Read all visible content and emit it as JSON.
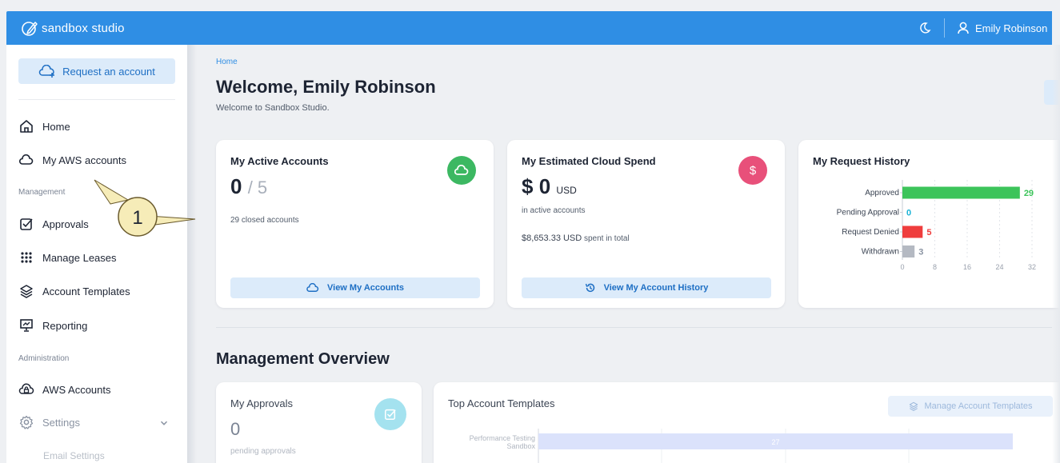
{
  "topbar": {
    "brand": "sandbox studio",
    "user_name": "Emily Robinson"
  },
  "sidebar": {
    "request_button": "Request an account",
    "items": [
      {
        "label": "Home",
        "icon": "home-icon"
      },
      {
        "label": "My AWS accounts",
        "icon": "cloud-icon"
      },
      {
        "label": "Approvals",
        "icon": "checkbox-icon"
      },
      {
        "label": "Manage Leases",
        "icon": "grid-dots-icon"
      },
      {
        "label": "Account Templates",
        "icon": "stack-icon"
      },
      {
        "label": "Reporting",
        "icon": "presentation-icon"
      },
      {
        "label": "AWS Accounts",
        "icon": "cloud-lock-icon"
      },
      {
        "label": "Settings",
        "icon": "gear-icon"
      },
      {
        "label": "Email Settings",
        "icon": ""
      }
    ],
    "sections": {
      "management": "Management",
      "administration": "Administration"
    }
  },
  "callout": {
    "number": "1"
  },
  "main": {
    "breadcrumb": "Home",
    "title": "Welcome, Emily Robinson",
    "subtitle": "Welcome to Sandbox Studio.",
    "active_accounts": {
      "title": "My Active Accounts",
      "count": "0",
      "limit": "/ 5",
      "closed_count": "29",
      "closed_label": "closed accounts",
      "button": "View My Accounts"
    },
    "cloud_spend": {
      "title": "My Estimated Cloud Spend",
      "currency_symbol": "$",
      "amount": "0",
      "currency": "USD",
      "note": "in active accounts",
      "total": "$8,653.33 USD",
      "total_label": "spent in total",
      "button": "View My Account History"
    },
    "request_history": {
      "title": "My Request History"
    },
    "management_overview": {
      "title": "Management Overview",
      "approvals": {
        "title": "My Approvals",
        "count": "0",
        "label": "pending approvals"
      },
      "top_templates": {
        "title": "Top Account Templates",
        "button": "Manage Account Templates"
      }
    }
  },
  "colors": {
    "topbar": "#2f8ee4",
    "approved": "#3cc45a",
    "pending": "#19b2d6",
    "denied": "#ef3d3d",
    "withdrawn": "#b4b9c2",
    "green_icon": "#3cb862",
    "pink_icon": "#e8507a"
  },
  "chart_data": [
    {
      "type": "bar",
      "orientation": "horizontal",
      "title": "My Request History",
      "categories": [
        "Approved",
        "Pending Approval",
        "Request Denied",
        "Withdrawn"
      ],
      "values": [
        29,
        0,
        5,
        3
      ],
      "x_ticks": [
        "0",
        "8",
        "16",
        "24",
        "32"
      ],
      "xlim": [
        0,
        32
      ]
    },
    {
      "type": "bar",
      "orientation": "horizontal",
      "title": "Top Account Templates",
      "categories": [
        "Performance Testing Sandbox"
      ],
      "values": [
        27
      ]
    }
  ]
}
